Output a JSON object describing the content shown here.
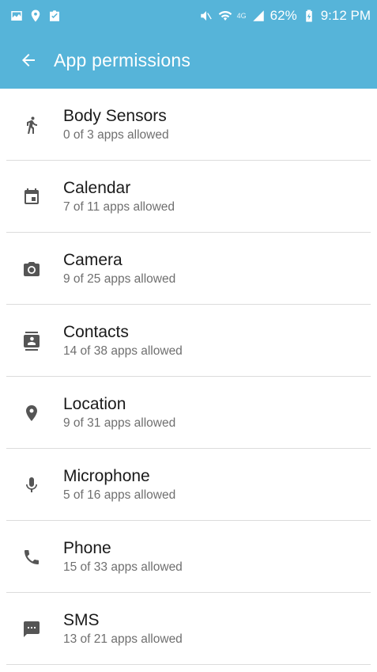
{
  "status_bar": {
    "battery": "62%",
    "time": "9:12 PM",
    "network_label": "4G",
    "icons_left": [
      "gallery-icon",
      "location-pin-icon",
      "clipboard-check-icon"
    ],
    "icons_right": [
      "mute-icon",
      "wifi-icon",
      "signal-icon",
      "battery-icon"
    ]
  },
  "header": {
    "title": "App permissions",
    "back_icon": "arrow-left-icon",
    "color": "#56b4d9"
  },
  "permissions": [
    {
      "name": "Body Sensors",
      "status": "0 of 3 apps allowed",
      "icon": "running-person-icon"
    },
    {
      "name": "Calendar",
      "status": "7 of 11 apps allowed",
      "icon": "calendar-icon"
    },
    {
      "name": "Camera",
      "status": "9 of 25 apps allowed",
      "icon": "camera-icon"
    },
    {
      "name": "Contacts",
      "status": "14 of 38 apps allowed",
      "icon": "contacts-icon"
    },
    {
      "name": "Location",
      "status": "9 of 31 apps allowed",
      "icon": "location-icon"
    },
    {
      "name": "Microphone",
      "status": "5 of 16 apps allowed",
      "icon": "microphone-icon"
    },
    {
      "name": "Phone",
      "status": "15 of 33 apps allowed",
      "icon": "phone-icon"
    },
    {
      "name": "SMS",
      "status": "13 of 21 apps allowed",
      "icon": "sms-icon"
    }
  ]
}
